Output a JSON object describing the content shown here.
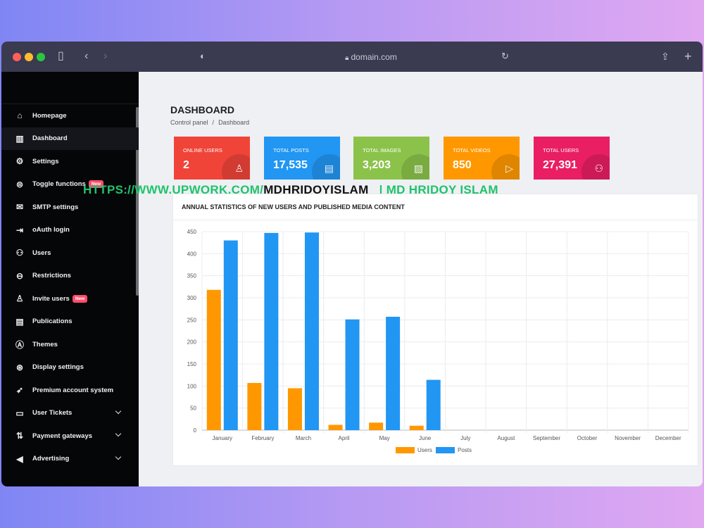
{
  "browser": {
    "url": "domain.com"
  },
  "sidebar": {
    "items": [
      {
        "label": "Homepage",
        "icon": "home-icon",
        "glyph": "⌂"
      },
      {
        "label": "Dashboard",
        "icon": "bar-chart-icon",
        "glyph": "▥"
      },
      {
        "label": "Settings",
        "icon": "gear-icon",
        "glyph": "⚙"
      },
      {
        "label": "Toggle functions",
        "icon": "toggle-icon",
        "glyph": "⊜",
        "badge": "New"
      },
      {
        "label": "SMTP settings",
        "icon": "mail-icon",
        "glyph": "✉"
      },
      {
        "label": "oAuth login",
        "icon": "login-icon",
        "glyph": "⇥"
      },
      {
        "label": "Users",
        "icon": "users-icon",
        "glyph": "⚇"
      },
      {
        "label": "Restrictions",
        "icon": "restriction-icon",
        "glyph": "⊖"
      },
      {
        "label": "Invite users",
        "icon": "user-plus-icon",
        "glyph": "♙",
        "badge": "New"
      },
      {
        "label": "Publications",
        "icon": "publications-icon",
        "glyph": "▤"
      },
      {
        "label": "Themes",
        "icon": "themes-icon",
        "glyph": "Ⓐ"
      },
      {
        "label": "Display settings",
        "icon": "display-icon",
        "glyph": "⊛"
      },
      {
        "label": "Premium account system",
        "icon": "rocket-icon",
        "glyph": "➶"
      },
      {
        "label": "User Tickets",
        "icon": "tickets-icon",
        "glyph": "▭"
      },
      {
        "label": "Payment gateways",
        "icon": "transfer-icon",
        "glyph": "⇅"
      },
      {
        "label": "Advertising",
        "icon": "megaphone-icon",
        "glyph": "◀"
      }
    ]
  },
  "header": {
    "title": "DASHBOARD",
    "breadcrumb": [
      "Control panel",
      "Dashboard"
    ]
  },
  "cards": [
    {
      "label": "ONLINE USERS",
      "value": "2",
      "color": "#f04438",
      "icon": "user-icon",
      "glyph": "♙"
    },
    {
      "label": "TOTAL POSTS",
      "value": "17,535",
      "color": "#2196f3",
      "icon": "post-icon",
      "glyph": "▤"
    },
    {
      "label": "TOTAL IMAGES",
      "value": "3,203",
      "color": "#8bc34a",
      "icon": "image-icon",
      "glyph": "▨"
    },
    {
      "label": "TOTAL VIDEOS",
      "value": "850",
      "color": "#ff9800",
      "icon": "play-icon",
      "glyph": "▷"
    },
    {
      "label": "TOTAL USERS",
      "value": "27,391",
      "color": "#e91e63",
      "icon": "users-icon",
      "glyph": "⚇"
    }
  ],
  "watermark": {
    "part1": "HTTPS://WWW.UPWORK.COM/",
    "part2": "MDHRIDOYISLAM",
    "part3": "| MD HRIDOY ISLAM"
  },
  "chart_panel": {
    "title": "ANNUAL STATISTICS OF NEW USERS AND PUBLISHED MEDIA CONTENT"
  },
  "chart_data": {
    "type": "bar",
    "title": "ANNUAL STATISTICS OF NEW USERS AND PUBLISHED MEDIA CONTENT",
    "categories": [
      "January",
      "February",
      "March",
      "April",
      "May",
      "June",
      "July",
      "August",
      "September",
      "October",
      "November",
      "December"
    ],
    "series": [
      {
        "name": "Users",
        "color": "#ff9800",
        "values": [
          318,
          107,
          95,
          12,
          17,
          10,
          0,
          0,
          0,
          0,
          0,
          0
        ]
      },
      {
        "name": "Posts",
        "color": "#2196f3",
        "values": [
          430,
          447,
          448,
          251,
          257,
          114,
          0,
          0,
          0,
          0,
          0,
          0
        ]
      }
    ],
    "yticks": [
      0,
      50,
      100,
      150,
      200,
      250,
      300,
      350,
      400,
      450
    ],
    "ylim": [
      0,
      450
    ],
    "grid": true,
    "legend": "bottom"
  }
}
